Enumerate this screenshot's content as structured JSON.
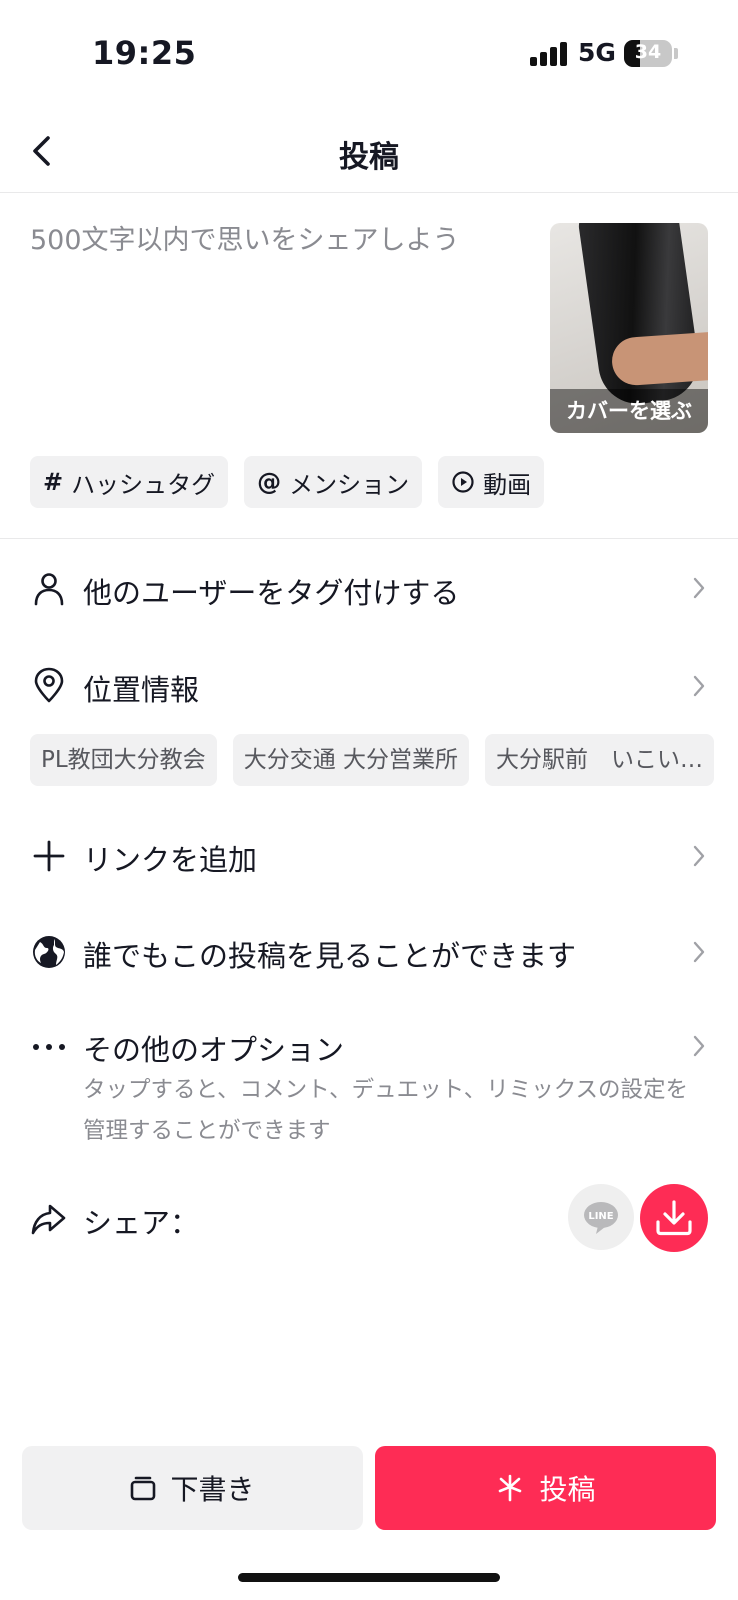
{
  "status_bar": {
    "time": "19:25",
    "network": "5G",
    "battery": "34",
    "battery_level": 0.34
  },
  "nav": {
    "title": "投稿"
  },
  "caption": {
    "placeholder": "500文字以内で思いをシェアしよう",
    "value": ""
  },
  "cover": {
    "label": "カバーを選ぶ"
  },
  "chips": [
    {
      "symbol": "#",
      "label": "ハッシュタグ"
    },
    {
      "symbol": "@",
      "label": "メンション"
    },
    {
      "symbol": "play-circle-icon",
      "label": "動画"
    }
  ],
  "rows": {
    "tag_users": {
      "label": "他のユーザーをタグ付けする",
      "icon": "person-icon"
    },
    "location": {
      "label": "位置情報",
      "icon": "location-pin-icon"
    },
    "add_link": {
      "label": "リンクを追加",
      "icon": "plus-icon"
    },
    "visibility": {
      "label": "誰でもこの投稿を見ることができます",
      "icon": "globe-icon"
    },
    "more_options": {
      "label": "その他のオプション",
      "description": "タップすると、コメント、デュエット、リミックスの設定を管理することができます",
      "icon": "more-dots-icon"
    },
    "share": {
      "label": "シェア：",
      "icon": "share-arrow-icon"
    }
  },
  "location_chips": [
    "PL教団大分教会",
    "大分交通 大分営業所",
    "大分駅前　いこい…"
  ],
  "share_targets": [
    {
      "name": "LINE",
      "color": "#efefef"
    },
    {
      "name": "download-icon",
      "color": "#fe2c55"
    }
  ],
  "bottom": {
    "draft_label": "下書き",
    "post_label": "投稿"
  },
  "colors": {
    "accent": "#fe2c55",
    "chip_bg": "#f1f1f2",
    "muted_text": "#8a8b91"
  }
}
